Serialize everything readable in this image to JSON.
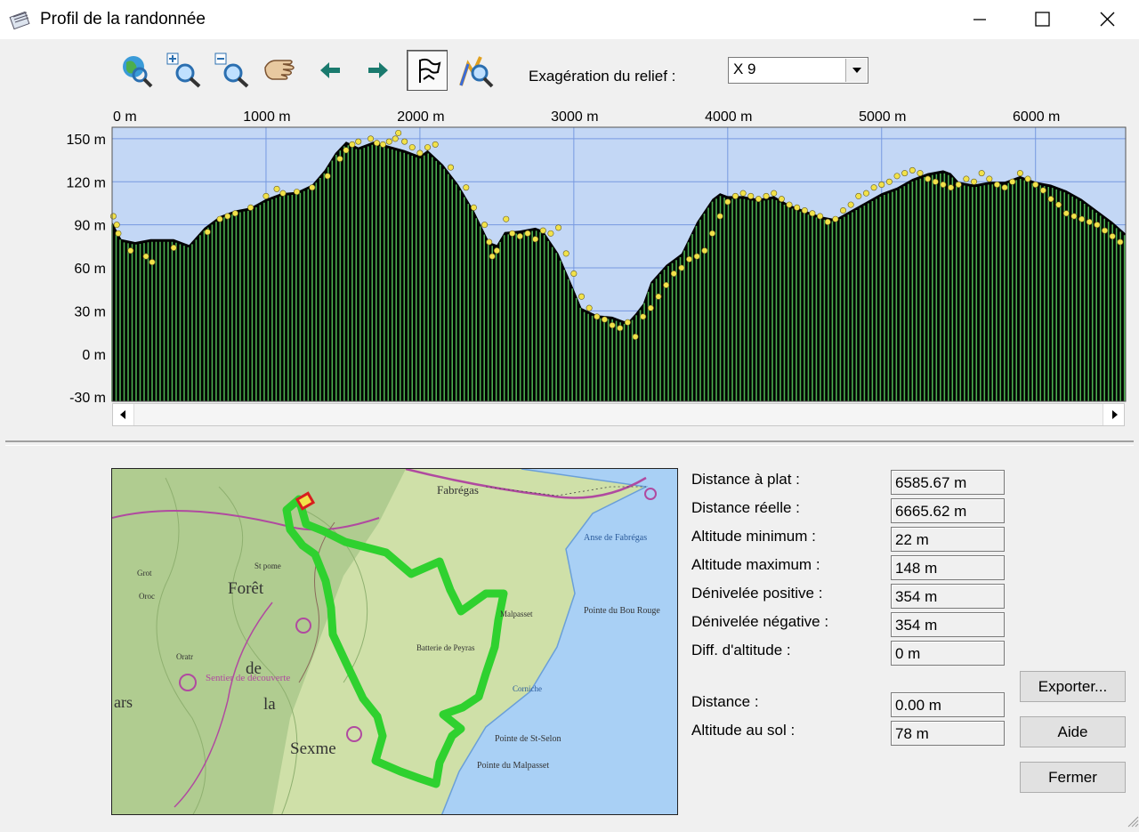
{
  "window": {
    "title": "Profil de la randonnée"
  },
  "toolbar": {
    "tools": [
      {
        "name": "globe-zoom-tool"
      },
      {
        "name": "zoom-in-tool"
      },
      {
        "name": "zoom-out-tool"
      },
      {
        "name": "pan-hand-tool"
      },
      {
        "name": "back-arrow"
      },
      {
        "name": "forward-arrow"
      },
      {
        "name": "flag-tool"
      },
      {
        "name": "profile-zoom-tool"
      }
    ],
    "exaggeration_label": "Exagération du relief :",
    "exaggeration_value": "X 9"
  },
  "chart_data": {
    "type": "area",
    "x_ticks": [
      "0 m",
      "1000 m",
      "2000 m",
      "3000 m",
      "4000 m",
      "5000 m",
      "6000 m"
    ],
    "y_ticks": [
      "150 m",
      "120 m",
      "90 m",
      "60 m",
      "30 m",
      "0 m",
      "-30 m"
    ],
    "xlim": [
      0,
      6585.67
    ],
    "ylim": [
      -33,
      158
    ],
    "grid": true,
    "colors": {
      "sky": "#c3d7f5",
      "grid": "#7799e0",
      "ground": "#000000",
      "bars": "#4caf50",
      "points": "#f2e24a"
    },
    "profile": {
      "x": [
        0,
        60,
        150,
        250,
        330,
        400,
        500,
        600,
        700,
        800,
        900,
        1000,
        1100,
        1200,
        1300,
        1380,
        1450,
        1520,
        1600,
        1700,
        1800,
        1900,
        2000,
        2050,
        2150,
        2250,
        2350,
        2450,
        2500,
        2550,
        2650,
        2750,
        2800,
        2900,
        3000,
        3050,
        3150,
        3250,
        3300,
        3350,
        3400,
        3450,
        3500,
        3600,
        3700,
        3800,
        3900,
        3950,
        4000,
        4050,
        4100,
        4200,
        4300,
        4400,
        4500,
        4600,
        4700,
        4800,
        4900,
        5000,
        5100,
        5200,
        5300,
        5400,
        5450,
        5500,
        5600,
        5700,
        5800,
        5900,
        6000,
        6100,
        6200,
        6300,
        6400,
        6500,
        6585
      ],
      "y": [
        92,
        80,
        78,
        80,
        80,
        80,
        76,
        88,
        96,
        100,
        102,
        108,
        112,
        113,
        118,
        128,
        140,
        148,
        144,
        148,
        145,
        142,
        138,
        142,
        132,
        118,
        100,
        78,
        76,
        85,
        86,
        88,
        86,
        70,
        45,
        32,
        27,
        26,
        24,
        22,
        28,
        35,
        50,
        62,
        70,
        92,
        108,
        112,
        110,
        110,
        110,
        108,
        110,
        104,
        100,
        96,
        94,
        100,
        106,
        112,
        116,
        122,
        126,
        128,
        126,
        120,
        118,
        120,
        120,
        124,
        120,
        118,
        114,
        108,
        100,
        92,
        84
      ]
    },
    "points": {
      "x": [
        8,
        30,
        40,
        120,
        220,
        260,
        400,
        620,
        700,
        750,
        800,
        900,
        1000,
        1070,
        1110,
        1200,
        1300,
        1400,
        1480,
        1520,
        1560,
        1600,
        1680,
        1720,
        1760,
        1800,
        1840,
        1860,
        1900,
        1950,
        2000,
        2050,
        2100,
        2200,
        2300,
        2350,
        2420,
        2450,
        2470,
        2500,
        2560,
        2600,
        2650,
        2700,
        2750,
        2800,
        2850,
        2900,
        2950,
        3000,
        3050,
        3100,
        3150,
        3200,
        3250,
        3300,
        3350,
        3400,
        3450,
        3500,
        3550,
        3600,
        3650,
        3700,
        3750,
        3800,
        3850,
        3900,
        3950,
        4000,
        4050,
        4100,
        4150,
        4200,
        4250,
        4300,
        4350,
        4400,
        4450,
        4500,
        4550,
        4600,
        4650,
        4700,
        4750,
        4800,
        4850,
        4900,
        4950,
        5000,
        5050,
        5100,
        5150,
        5200,
        5250,
        5300,
        5350,
        5400,
        5450,
        5500,
        5550,
        5600,
        5650,
        5700,
        5750,
        5800,
        5850,
        5900,
        5950,
        6000,
        6050,
        6100,
        6150,
        6200,
        6250,
        6300,
        6350,
        6400,
        6450,
        6500,
        6550
      ],
      "y": [
        96,
        90,
        84,
        72,
        68,
        64,
        74,
        85,
        94,
        96,
        98,
        102,
        110,
        115,
        112,
        113,
        116,
        124,
        136,
        142,
        146,
        148,
        150,
        147,
        146,
        148,
        150,
        154,
        148,
        144,
        140,
        144,
        146,
        130,
        116,
        102,
        90,
        78,
        68,
        72,
        94,
        84,
        82,
        84,
        80,
        86,
        84,
        88,
        70,
        56,
        40,
        32,
        26,
        24,
        20,
        18,
        22,
        12,
        26,
        32,
        40,
        48,
        56,
        60,
        66,
        68,
        72,
        84,
        96,
        106,
        110,
        112,
        110,
        108,
        110,
        112,
        108,
        104,
        102,
        100,
        98,
        96,
        92,
        94,
        100,
        104,
        110,
        112,
        116,
        118,
        120,
        124,
        126,
        128,
        126,
        122,
        120,
        118,
        116,
        118,
        122,
        120,
        126,
        122,
        118,
        116,
        120,
        126,
        122,
        118,
        114,
        108,
        104,
        98,
        96,
        94,
        92,
        90,
        86,
        82,
        78
      ]
    }
  },
  "stats": [
    {
      "label": "Distance à plat :",
      "value": "6585.67 m"
    },
    {
      "label": "Distance réelle :",
      "value": "6665.62 m"
    },
    {
      "label": "Altitude minimum :",
      "value": "22 m"
    },
    {
      "label": "Altitude maximum :",
      "value": "148 m"
    },
    {
      "label": "Dénivelée positive :",
      "value": "354 m"
    },
    {
      "label": "Dénivelée négative :",
      "value": "354 m"
    },
    {
      "label": "Diff. d'altitude :",
      "value": "0 m"
    },
    {
      "label": "Distance :",
      "value": "0.00 m"
    },
    {
      "label": "Altitude au sol :",
      "value": "78 m"
    }
  ],
  "map": {
    "labels": [
      "Fabrégas",
      "Anse de Fabrégas",
      "Pointe du Bou Rouge",
      "Batterie de Peyras",
      "Pointe de St-Selon",
      "Pointe du Malpasset",
      "Forêt",
      "de",
      "la",
      "Sexme",
      "Sentier de découverte",
      "Oratr",
      "Grot",
      "Oroc",
      "ars",
      "Corniche",
      "St pome",
      "Malpasset"
    ],
    "colors": {
      "land": "#cfe0a8",
      "forest": "#a8c78a",
      "sea": "#a9d0f5",
      "track": "#2fd12f",
      "road": "#b04aa0"
    }
  },
  "buttons": {
    "export": "Exporter...",
    "help": "Aide",
    "close": "Fermer"
  }
}
